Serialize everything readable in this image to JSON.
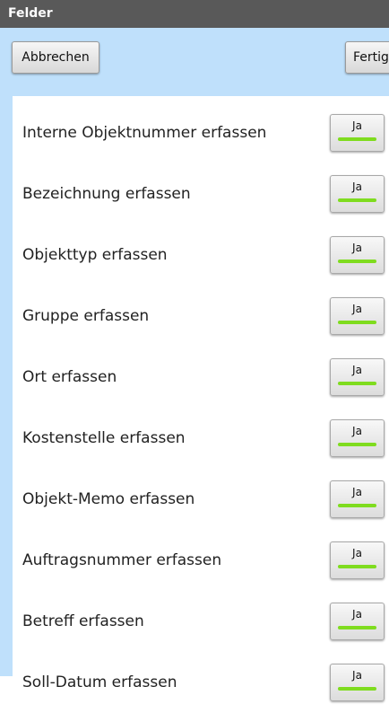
{
  "window": {
    "title": "Felder"
  },
  "toolbar": {
    "cancel_label": "Abbrechen",
    "done_label": "Fertig"
  },
  "fields": [
    {
      "label": "Interne Objektnummer erfassen",
      "toggle_text": "Ja",
      "enabled": true
    },
    {
      "label": "Bezeichnung erfassen",
      "toggle_text": "Ja",
      "enabled": true
    },
    {
      "label": "Objekttyp erfassen",
      "toggle_text": "Ja",
      "enabled": true
    },
    {
      "label": "Gruppe erfassen",
      "toggle_text": "Ja",
      "enabled": true
    },
    {
      "label": "Ort erfassen",
      "toggle_text": "Ja",
      "enabled": true
    },
    {
      "label": "Kostenstelle erfassen",
      "toggle_text": "Ja",
      "enabled": true
    },
    {
      "label": "Objekt-Memo erfassen",
      "toggle_text": "Ja",
      "enabled": true
    },
    {
      "label": "Auftragsnummer erfassen",
      "toggle_text": "Ja",
      "enabled": true
    },
    {
      "label": "Betreff erfassen",
      "toggle_text": "Ja",
      "enabled": true
    },
    {
      "label": "Soll-Datum erfassen",
      "toggle_text": "Ja",
      "enabled": true
    }
  ],
  "colors": {
    "titlebar": "#595959",
    "accent_panel": "#bfe0fb",
    "toggle_on_indicator": "#7fdc1f"
  }
}
